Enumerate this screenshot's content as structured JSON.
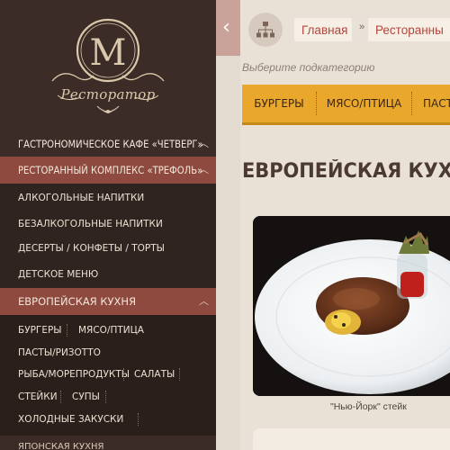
{
  "sidebar": {
    "logo_letter": "М",
    "logo_text": "Ресторатор",
    "items": [
      {
        "label": "ГАСТРОНОМИЧЕСКОЕ КАФЕ «ЧЕТВЕРГ»"
      },
      {
        "label": "РЕСТОРАННЫЙ КОМПЛЕКС «ТРЕФОЛЬ»"
      }
    ],
    "sub_items": [
      {
        "label": "АЛКОГОЛЬНЫЕ НАПИТКИ"
      },
      {
        "label": "БЕЗАЛКОГОЛЬНЫЕ НАПИТКИ"
      },
      {
        "label": "ДЕСЕРТЫ / КОНФЕТЫ / ТОРТЫ"
      },
      {
        "label": "ДЕТСКОЕ МЕНЮ"
      }
    ],
    "active_item": {
      "label": "ЕВРОПЕЙСКАЯ КУХНЯ"
    },
    "tags": [
      "БУРГЕРЫ",
      "МЯСО/ПТИЦА",
      "ПАСТЫ/РИЗОТТО",
      "РЫБА/МОРЕПРОДУКТЫ",
      "САЛАТЫ",
      "СТЕЙКИ",
      "СУПЫ",
      "ХОЛОДНЫЕ ЗАКУСКИ"
    ],
    "bottom_item": {
      "label": "ЯПОНСКАЯ КУХНЯ"
    },
    "expanded_icon": "chevron-up-icon"
  },
  "toggle": {
    "icon": "chevron-left-icon",
    "glyph": "‹"
  },
  "breadcrumb": {
    "icon": "sitemap-icon",
    "home": "Главная",
    "separator": "»",
    "current": "Ресторанны"
  },
  "subcategory_label": "Выберите подкатегорию",
  "tabs": [
    "БУРГЕРЫ",
    "МЯСО/ПТИЦА",
    "ПАСТ"
  ],
  "heading": "ЕВРОПЕЙСКАЯ КУХНЯ",
  "dish": {
    "caption": "\"Нью-Йорк\" стейк"
  },
  "colors": {
    "sidebar_bg": "#3c2c27",
    "active_row": "#8e4a3e",
    "accent_tabs": "#e9a82b",
    "link": "#b3453a",
    "page_bg": "#e9e1d6"
  }
}
